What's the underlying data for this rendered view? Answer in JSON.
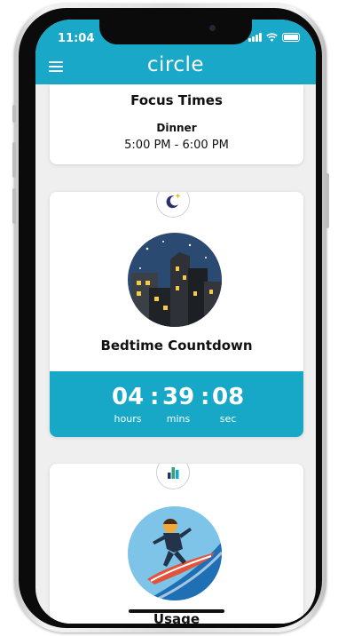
{
  "status_bar": {
    "time": "11:04"
  },
  "app_bar": {
    "logo": "circle"
  },
  "focus_card": {
    "title": "Focus Times",
    "label": "Dinner",
    "time_range": "5:00 PM - 6:00 PM"
  },
  "bedtime_card": {
    "title": "Bedtime Countdown",
    "hours": "04",
    "mins": "39",
    "secs": "08",
    "separator": ":",
    "units": {
      "hours": "hours",
      "mins": "mins",
      "secs": "sec"
    }
  },
  "usage_card": {
    "title": "Usage"
  },
  "colors": {
    "brand": "#1aa8c8",
    "countdown_band": "#17a8c8",
    "badge_icon": "#2a2f6e"
  },
  "icons": [
    "menu-icon",
    "moon-star-icon",
    "bar-chart-icon",
    "signal-icon",
    "wifi-icon",
    "battery-icon"
  ]
}
